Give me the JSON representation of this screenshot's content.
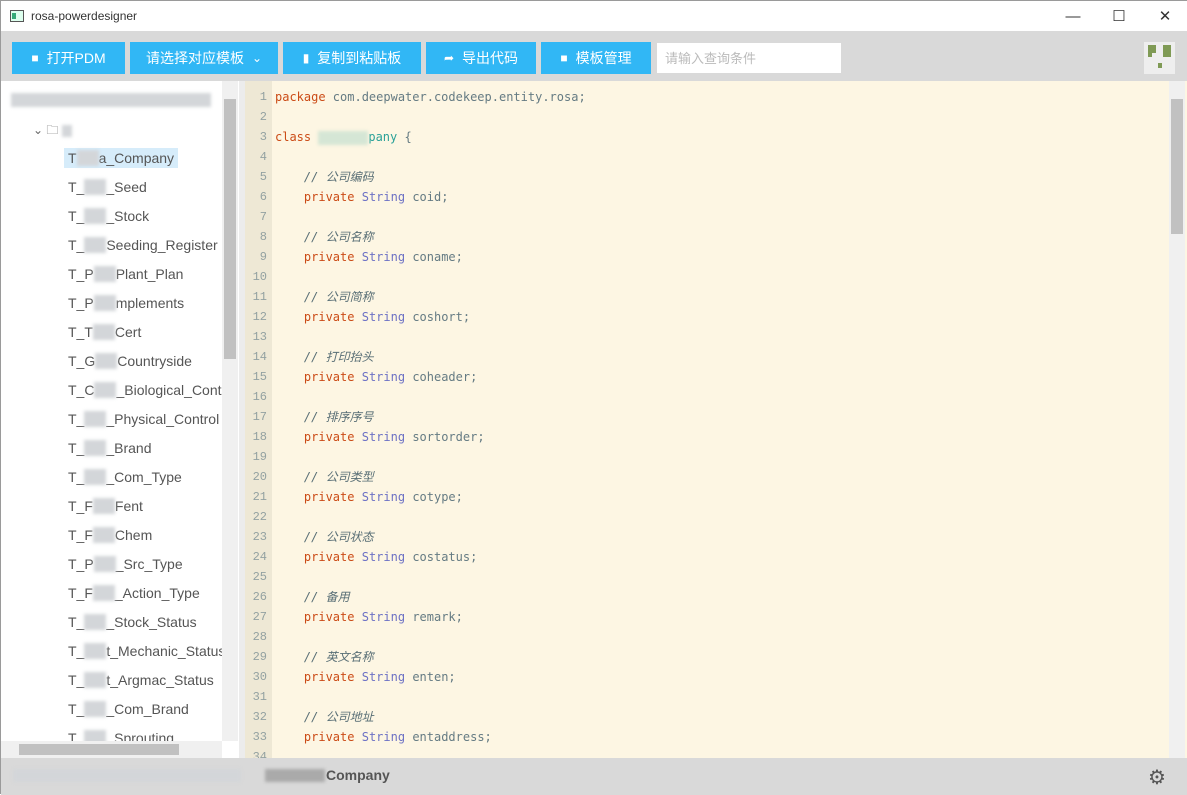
{
  "window": {
    "title": "rosa-powerdesigner",
    "minimize": "—",
    "maximize": "☐",
    "close": "✕"
  },
  "toolbar": {
    "open_pdm": "打开PDM",
    "template_select": "请选择对应模板",
    "copy": "复制到粘贴板",
    "export": "导出代码",
    "template_manage": "模板管理",
    "search_placeholder": "请输入查询条件",
    "search_value": ""
  },
  "accent_color": "#31b7f5",
  "tree": {
    "items": [
      {
        "prefix": "T",
        "suffix": "a_Company",
        "selected": true
      },
      {
        "prefix": "T_",
        "suffix": "_Seed"
      },
      {
        "prefix": "T_",
        "suffix": "_Stock"
      },
      {
        "prefix": "T_",
        "suffix": "Seeding_Register"
      },
      {
        "prefix": "T_P",
        "suffix": "Plant_Plan"
      },
      {
        "prefix": "T_P",
        "suffix": "mplements"
      },
      {
        "prefix": "T_T",
        "suffix": "Cert"
      },
      {
        "prefix": "T_G",
        "suffix": "Countryside"
      },
      {
        "prefix": "T_C",
        "suffix": "_Biological_Control"
      },
      {
        "prefix": "T_",
        "suffix": "_Physical_Control"
      },
      {
        "prefix": "T_",
        "suffix": "_Brand"
      },
      {
        "prefix": "T_",
        "suffix": "_Com_Type"
      },
      {
        "prefix": "T_F",
        "suffix": "Fent"
      },
      {
        "prefix": "T_F",
        "suffix": "Chem"
      },
      {
        "prefix": "T_P",
        "suffix": "_Src_Type"
      },
      {
        "prefix": "T_F",
        "suffix": "_Action_Type"
      },
      {
        "prefix": "T_",
        "suffix": "_Stock_Status"
      },
      {
        "prefix": "T_",
        "suffix": "t_Mechanic_Status"
      },
      {
        "prefix": "T_",
        "suffix": "t_Argmac_Status"
      },
      {
        "prefix": "T_",
        "suffix": "_Com_Brand"
      },
      {
        "prefix": "T_",
        "suffix": "_Sprouting"
      }
    ]
  },
  "editor": {
    "package_kw": "package",
    "package_name": " com.deepwater.codekeep.entity.rosa;",
    "class_kw": "class",
    "class_name": "pany",
    "class_brace": " {",
    "private_kw": "private",
    "string_type": "String",
    "fields": [
      {
        "comment": "// 公司编码",
        "name": "coid;"
      },
      {
        "comment": "// 公司名称",
        "name": "coname;"
      },
      {
        "comment": "// 公司简称",
        "name": "coshort;"
      },
      {
        "comment": "// 打印抬头",
        "name": "coheader;"
      },
      {
        "comment": "// 排序序号",
        "name": "sortorder;"
      },
      {
        "comment": "// 公司类型",
        "name": "cotype;"
      },
      {
        "comment": "// 公司状态",
        "name": "costatus;"
      },
      {
        "comment": "// 备用",
        "name": "remark;"
      },
      {
        "comment": "// 英文名称",
        "name": "enten;"
      },
      {
        "comment": "// 公司地址",
        "name": "entaddress;"
      }
    ]
  },
  "status": {
    "text": "Company"
  }
}
